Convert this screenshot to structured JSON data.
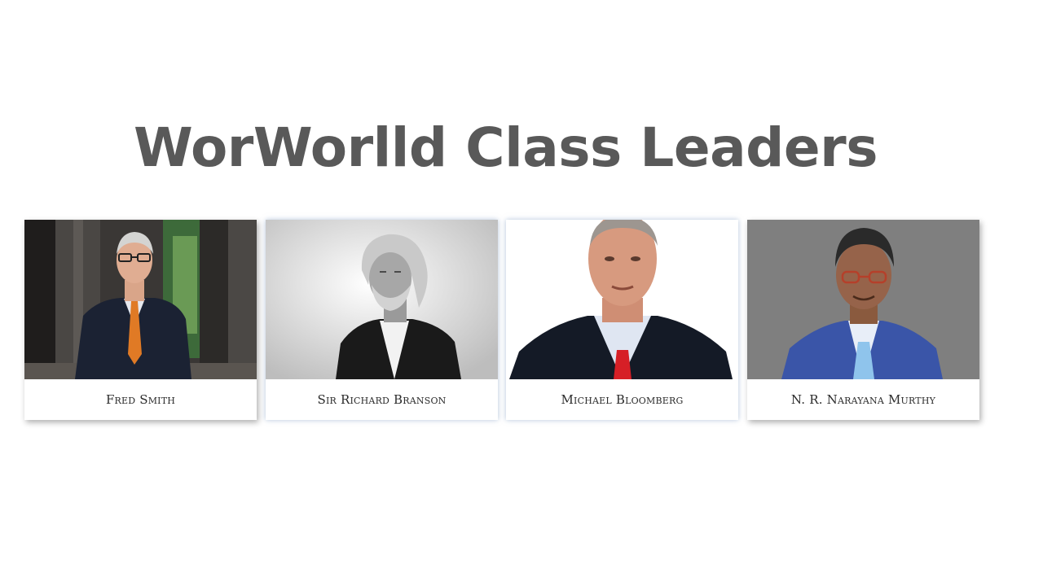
{
  "slide": {
    "title": "WorWorlld Class Leaders",
    "title_color": "#595959",
    "background": "#ffffff"
  },
  "leaders": [
    {
      "name": "Fred Smith"
    },
    {
      "name": "Sir Richard Branson"
    },
    {
      "name": "Michael Bloomberg"
    },
    {
      "name": "N. R. Narayana Murthy"
    }
  ]
}
